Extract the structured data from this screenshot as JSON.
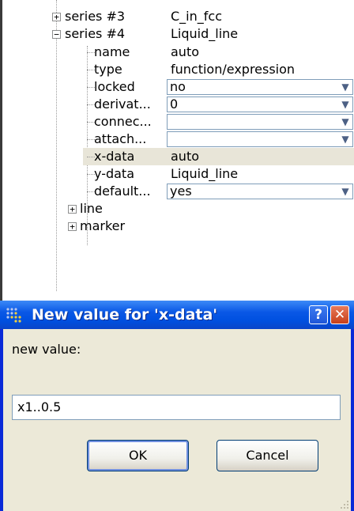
{
  "tree": {
    "series3": {
      "label": "series #3",
      "value": "C_in_fcc",
      "toggle": "+"
    },
    "series4": {
      "label": "series #4",
      "value": "Liquid_line",
      "toggle": "−"
    },
    "props": [
      {
        "label": "name",
        "value": "auto",
        "kind": "text"
      },
      {
        "label": "type",
        "value": "function/expression",
        "kind": "text"
      },
      {
        "label": "locked",
        "value": "no",
        "kind": "combo"
      },
      {
        "label": "derivat...",
        "value": "0",
        "kind": "combo"
      },
      {
        "label": "connec...",
        "value": "",
        "kind": "combo"
      },
      {
        "label": "attach...",
        "value": "",
        "kind": "combo"
      },
      {
        "label": "x-data",
        "value": "auto",
        "kind": "text"
      },
      {
        "label": "y-data",
        "value": "Liquid_line",
        "kind": "text"
      },
      {
        "label": "default...",
        "value": "yes",
        "kind": "combo"
      }
    ],
    "line": {
      "label": "line",
      "toggle": "+"
    },
    "marker": {
      "label": "marker",
      "toggle": "+"
    },
    "dropdown_icon": "chevron-down-icon"
  },
  "dialog": {
    "title": "New value for 'x-data'",
    "help_label": "?",
    "close_label": "✕",
    "prompt": "new value:",
    "input_value": "x1..0.5",
    "ok_label": "OK",
    "cancel_label": "Cancel"
  },
  "colors": {
    "titlebar": "#0a58e6",
    "client_bg": "#ece9d8",
    "selected_row": "#e8e5d8",
    "close_button": "#c73f1a"
  }
}
